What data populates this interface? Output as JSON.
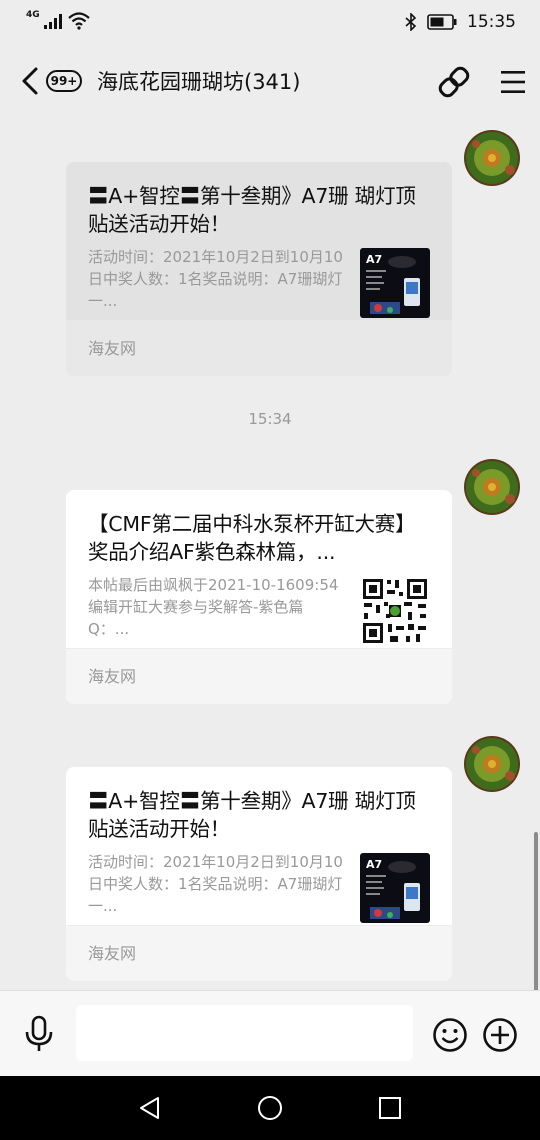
{
  "status_bar": {
    "network": "4G",
    "time": "15:35"
  },
  "header": {
    "back_badge": "99+",
    "title": "海底花园珊瑚坊(341)"
  },
  "messages": [
    {
      "title": "〓A+智控〓第十叁期》A7珊 瑚灯顶贴送活动开始！",
      "description": "活动时间：2021年10月2日到10月10日中奖人数：1名奖品说明：A7珊瑚灯一...",
      "source": "海友网",
      "thumb_label": "A7",
      "thumb_type": "product"
    },
    {
      "title": "【CMF第二届中科水泵杯开缸大赛】奖品介绍AF紫色森林篇，...",
      "description": "本帖最后由飒枫于2021-10-1609:54编辑开缸大赛参与奖解答-紫色篇Q：...",
      "source": "海友网",
      "thumb_type": "qr"
    },
    {
      "title": "〓A+智控〓第十叁期》A7珊 瑚灯顶贴送活动开始！",
      "description": "活动时间：2021年10月2日到10月10日中奖人数：1名奖品说明：A7珊瑚灯一...",
      "source": "海友网",
      "thumb_label": "A7",
      "thumb_type": "product"
    }
  ],
  "timestamp_divider": "15:34",
  "input_bar": {
    "value": "",
    "placeholder": ""
  },
  "icons": {
    "signal": "signal-icon",
    "wifi": "wifi-icon",
    "bluetooth": "bluetooth-icon",
    "battery": "battery-icon",
    "back": "chevron-left-icon",
    "link": "link-icon",
    "menu": "menu-icon",
    "voice": "microphone-icon",
    "emoji": "smiley-icon",
    "plus": "plus-circle-icon",
    "sys_back": "triangle-back-icon",
    "sys_home": "circle-home-icon",
    "sys_recent": "square-recent-icon"
  },
  "colors": {
    "chat_background": "#ededed",
    "selected_card": "#e2e2e2",
    "card": "#ffffff",
    "secondary_text": "#999999"
  }
}
